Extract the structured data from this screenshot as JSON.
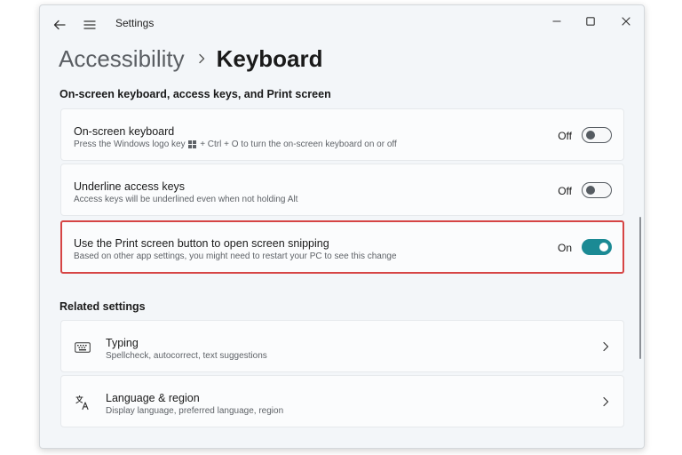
{
  "window": {
    "app_title": "Settings",
    "buttons": {
      "back": "back-arrow-icon",
      "menu": "hamburger-menu-icon",
      "minimize": "minimize-icon",
      "maximize": "maximize-icon",
      "close": "close-icon"
    }
  },
  "breadcrumb": {
    "parent": "Accessibility",
    "current": "Keyboard"
  },
  "sections": {
    "onscreen": {
      "title": "On-screen keyboard, access keys, and Print screen",
      "items": [
        {
          "title": "On-screen keyboard",
          "desc_prefix": "Press the Windows logo key",
          "desc_suffix": "+ Ctrl + O to turn the on-screen keyboard on or off",
          "state": "Off",
          "toggle_on": false
        },
        {
          "title": "Underline access keys",
          "desc": "Access keys will be underlined even when not holding Alt",
          "state": "Off",
          "toggle_on": false
        },
        {
          "title": "Use the Print screen button to open screen snipping",
          "desc": "Based on other app settings, you might need to restart your PC to see this change",
          "state": "On",
          "toggle_on": true
        }
      ]
    },
    "related": {
      "title": "Related settings",
      "items": [
        {
          "title": "Typing",
          "desc": "Spellcheck, autocorrect, text suggestions",
          "icon": "keyboard-icon"
        },
        {
          "title": "Language & region",
          "desc": "Display language, preferred language, region",
          "icon": "language-icon"
        }
      ]
    }
  },
  "colors": {
    "accent": "#1b8a94",
    "highlight": "#d64545",
    "window_bg": "#f3f6f9",
    "card_bg": "#fbfcfd"
  }
}
